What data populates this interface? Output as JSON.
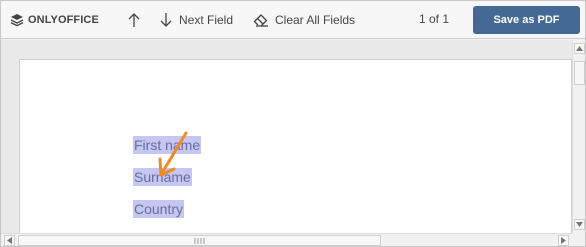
{
  "toolbar": {
    "logo_text": "ONLYOFFICE",
    "next_field_label": "Next Field",
    "clear_all_label": "Clear All Fields",
    "page_indicator": "1 of 1",
    "save_label": "Save as PDF"
  },
  "document": {
    "fields": [
      {
        "label": "First name"
      },
      {
        "label": "Surname"
      },
      {
        "label": "Country"
      }
    ]
  },
  "colors": {
    "accent": "#446995",
    "field_highlight": "#c6c6f2",
    "annotation_arrow": "#f08a24"
  },
  "icons": {
    "logo": "layers-icon",
    "prev": "arrow-up-icon",
    "next": "arrow-down-icon",
    "clear": "eraser-icon"
  }
}
